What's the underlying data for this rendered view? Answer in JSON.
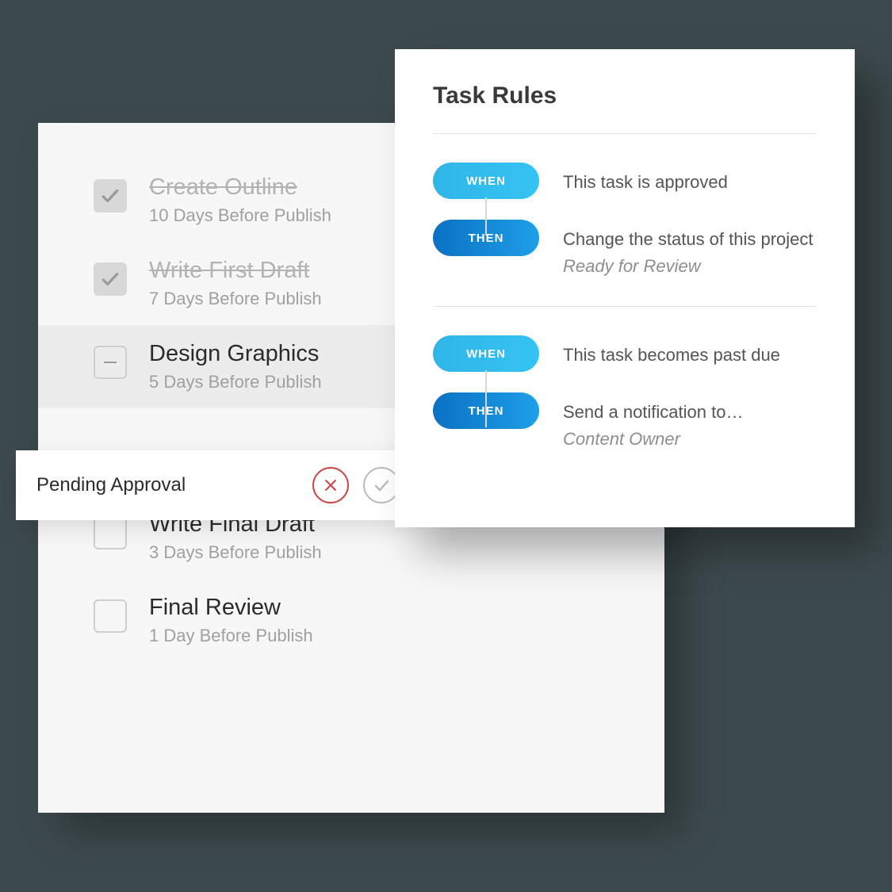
{
  "tasks": {
    "items": [
      {
        "title": "Create Outline",
        "sub": "10 Days Before Publish",
        "state": "done"
      },
      {
        "title": "Write First Draft",
        "sub": "7 Days Before Publish",
        "state": "done"
      },
      {
        "title": "Design Graphics",
        "sub": "5 Days Before Publish",
        "state": "active"
      },
      {
        "title": "Write Final Draft",
        "sub": "3 Days Before Publish",
        "state": "todo"
      },
      {
        "title": "Final Review",
        "sub": "1 Day Before Publish",
        "state": "todo"
      }
    ]
  },
  "approval": {
    "label": "Pending Approval"
  },
  "rules": {
    "title": "Task Rules",
    "pill_when": "WHEN",
    "pill_then": "THEN",
    "groups": [
      {
        "when": "This task is approved",
        "then": "Change the status of this project",
        "then_value": "Ready for Review"
      },
      {
        "when": "This task becomes past due",
        "then": "Send a notification to…",
        "then_value": "Content Owner"
      }
    ]
  }
}
